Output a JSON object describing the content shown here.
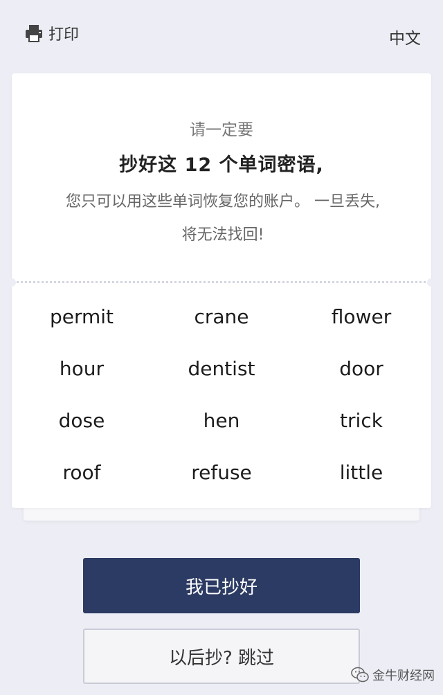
{
  "header": {
    "print_label": "打印",
    "language_label": "中文"
  },
  "card": {
    "subtitle": "请一定要",
    "headline": "抄好这 12 个单词密语,",
    "description": "您只可以用这些单词恢复您的账户。 一旦丢失,将无法找回!",
    "words": [
      "permit",
      "crane",
      "flower",
      "hour",
      "dentist",
      "door",
      "dose",
      "hen",
      "trick",
      "roof",
      "refuse",
      "little"
    ]
  },
  "actions": {
    "confirm_label": "我已抄好",
    "skip_label": "以后抄? 跳过"
  },
  "watermark": {
    "text": "金牛财经网"
  },
  "colors": {
    "background": "#edeef5",
    "primary_button": "#2c3b63"
  }
}
